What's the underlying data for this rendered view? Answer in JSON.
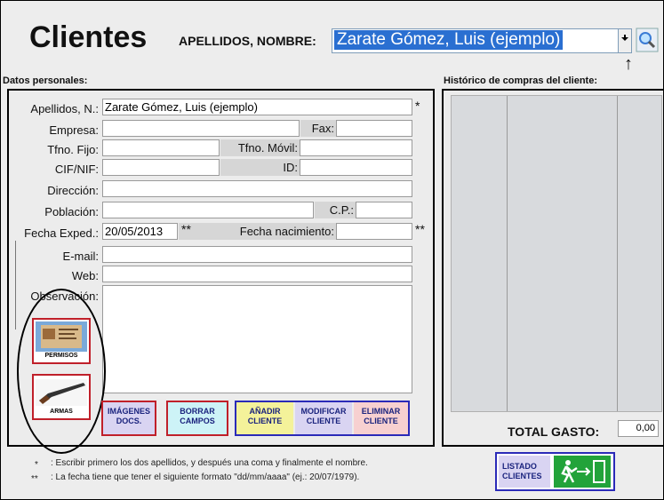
{
  "header": {
    "title": "Clientes",
    "apellidos_label": "APELLIDOS, NOMBRE:",
    "apellidos_value": "Zarate Gómez, Luis (ejemplo)"
  },
  "sections": {
    "datos_personales": "Datos personales:",
    "historico": "Histórico de compras del cliente:"
  },
  "form": {
    "apellidos_label": "Apellidos, N.:",
    "apellidos_value": "Zarate Gómez, Luis (ejemplo)",
    "empresa_label": "Empresa:",
    "fax_label": "Fax:",
    "tfno_fijo_label": "Tfno. Fijo:",
    "tfno_movil_label": "Tfno. Móvil:",
    "cif_label": "CIF/NIF:",
    "id_label": "ID:",
    "direccion_label": "Dirección:",
    "poblacion_label": "Población:",
    "cp_label": "C.P.:",
    "fecha_exped_label": "Fecha Exped.:",
    "fecha_exped_value": "20/05/2013",
    "fecha_nac_label": "Fecha nacimiento:",
    "email_label": "E-mail:",
    "web_label": "Web:",
    "observacion_label": "Observación:",
    "star_single": "*",
    "star_double": "**"
  },
  "image_buttons": {
    "permisos": "PERMISOS",
    "armas": "ARMAS"
  },
  "buttons": {
    "imagenes": [
      "IMÁGENES",
      "DOCS."
    ],
    "borrar": [
      "BORRAR",
      "CAMPOS"
    ],
    "anadir": [
      "AÑADIR",
      "CLIENTE"
    ],
    "modificar": [
      "MODIFICAR",
      "CLIENTE"
    ],
    "eliminar": [
      "ELIMINAR",
      "CLIENTE"
    ],
    "listado": [
      "LISTADO",
      "CLIENTES"
    ]
  },
  "history": {
    "total_label": "TOTAL GASTO:",
    "total_value": "0,00"
  },
  "footnotes": {
    "single_mark": "*",
    "single_text": ": Escribir primero los dos apellidos, y después una coma y finalmente el nombre.",
    "double_mark": "**",
    "double_text": ": La fecha tiene que tener el siguiente formato \"dd/mm/aaaa\" (ej.: 20/07/1979)."
  },
  "colors": {
    "selection": "#2a6fd1",
    "btn_red": "#c0202a",
    "btn_blue": "#2a2ab8",
    "btn_yellow": "#f4f29a",
    "btn_cyan": "#cdf3f7",
    "btn_lavender": "#d9d4f2",
    "btn_pink": "#f7d0d0",
    "exit_green": "#22a33a"
  },
  "icons": {
    "search": "magnifier-icon",
    "exit": "exit-door-icon"
  }
}
